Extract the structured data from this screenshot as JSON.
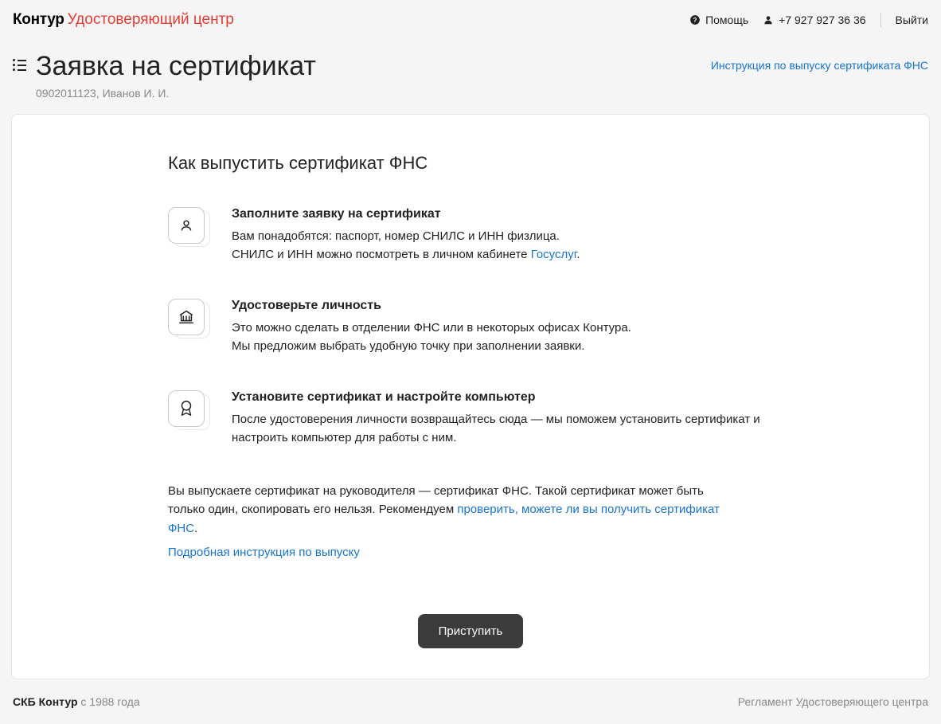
{
  "topbar": {
    "logo_main": "Контур",
    "logo_suffix": "Удостоверяющий центр",
    "help_label": "Помощь",
    "phone": "+7 927 927 36 36",
    "logout_label": "Выйти"
  },
  "header": {
    "title": "Заявка на сертификат",
    "subtitle": "0902011123, Иванов И. И.",
    "instruction_link": "Инструкция по выпуску сертификата ФНС"
  },
  "card": {
    "section_title": "Как выпустить сертификат ФНС",
    "steps": [
      {
        "title": "Заполните заявку на сертификат",
        "line1": "Вам понадобятся: паспорт, номер СНИЛС и ИНН физлица.",
        "line2_text": "СНИЛС и ИНН можно посмотреть в личном кабинете ",
        "line2_link": "Госуслуг",
        "line2_suffix": "."
      },
      {
        "title": "Удостоверьте личность",
        "line1": "Это можно сделать в отделении ФНС или в некоторых офисах Контура.",
        "line2": "Мы предложим выбрать удобную точку при заполнении заявки."
      },
      {
        "title": "Установите сертификат и настройте компьютер",
        "line1": "После удостоверения личности возвращайтесь сюда — мы поможем установить сертификат и настроить компьютер для работы с ним."
      }
    ],
    "note_text1": "Вы выпускаете сертификат на руководителя — сертификат ФНС. Такой сертификат может быть только один, скопировать его нельзя. Рекомендуем ",
    "note_link": "проверить, можете ли вы получить сертификат ФНС",
    "note_suffix": ".",
    "detail_link": "Подробная инструкция по выпуску",
    "primary_button": "Приступить"
  },
  "footer": {
    "company": "СКБ Контур",
    "since": " с 1988 года",
    "reglament": "Регламент Удостоверяющего центра"
  }
}
